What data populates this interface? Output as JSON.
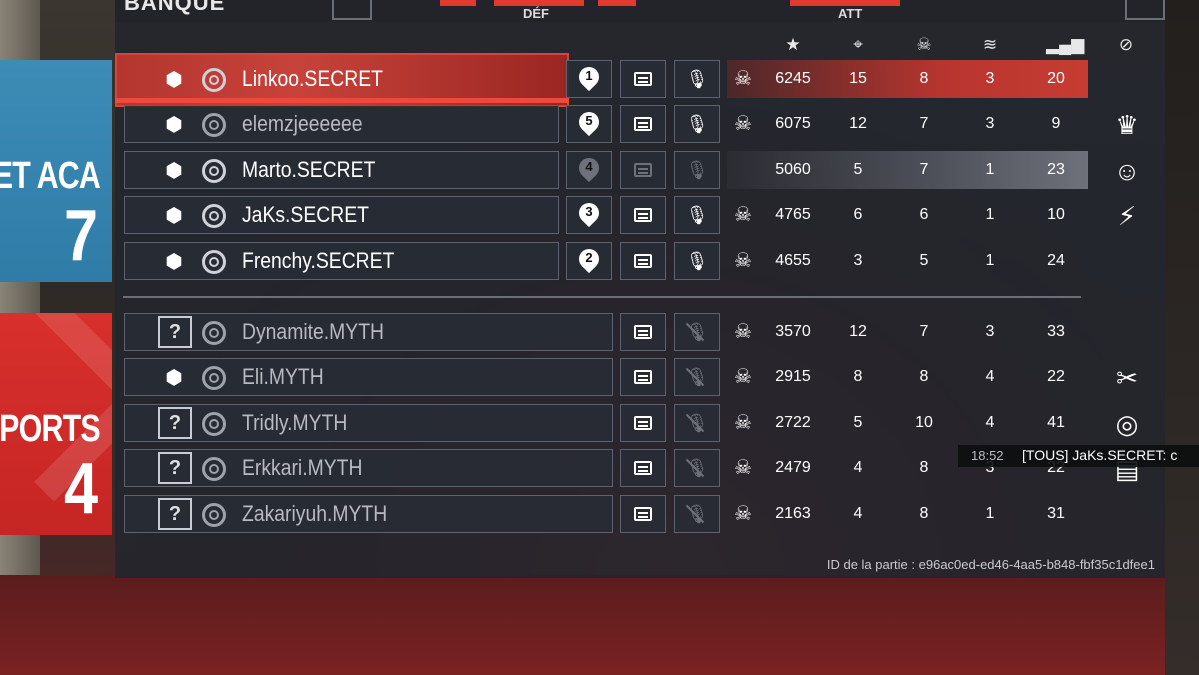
{
  "top": {
    "title": "BANQUE",
    "def_label": "DÉF",
    "att_label": "ATT"
  },
  "teams": [
    {
      "name": "ET ACA",
      "score": "7",
      "color": "#3a8ab4"
    },
    {
      "name": "PORTS",
      "score": "4",
      "color": "#d02a28"
    }
  ],
  "header_icons": [
    "star-icon",
    "crosshair-icon",
    "skull-icon",
    "wings-icon",
    "ping-bars-icon",
    "slash-circle-icon"
  ],
  "players": [
    {
      "name": "Linkoo.SECRET",
      "op": "op-icon",
      "pin": "1",
      "score": "6245",
      "kills": "15",
      "deaths": "8",
      "assists": "3",
      "ping": "20",
      "highlight": "red"
    },
    {
      "name": "elemzjeeeeee",
      "op": "op-icon",
      "pin": "5",
      "score": "6075",
      "kills": "12",
      "deaths": "7",
      "assists": "3",
      "ping": "9",
      "dim": true,
      "badge": "crown"
    },
    {
      "name": "Marto.SECRET",
      "op": "op-icon",
      "pin": "4",
      "score": "5060",
      "kills": "5",
      "deaths": "7",
      "assists": "1",
      "ping": "23",
      "disabled": true,
      "highlight": "gray",
      "badge": "face"
    },
    {
      "name": "JaKs.SECRET",
      "op": "op-icon",
      "pin": "3",
      "score": "4765",
      "kills": "6",
      "deaths": "6",
      "assists": "1",
      "ping": "10",
      "badge": "bolt"
    },
    {
      "name": "Frenchy.SECRET",
      "op": "op-icon",
      "pin": "2",
      "score": "4655",
      "kills": "3",
      "deaths": "5",
      "assists": "1",
      "ping": "24"
    },
    {
      "name": "Dynamite.MYTH",
      "op": "?",
      "score": "3570",
      "kills": "12",
      "deaths": "7",
      "assists": "3",
      "ping": "33",
      "dim": true
    },
    {
      "name": "Eli.MYTH",
      "op": "op-icon",
      "score": "2915",
      "kills": "8",
      "deaths": "8",
      "assists": "4",
      "ping": "22",
      "dim": true,
      "badge": "knife"
    },
    {
      "name": "Tridly.MYTH",
      "op": "?",
      "score": "2722",
      "kills": "5",
      "deaths": "10",
      "assists": "4",
      "ping": "41",
      "dim": true,
      "badge": "target"
    },
    {
      "name": "Erkkari.MYTH",
      "op": "?",
      "score": "2479",
      "kills": "4",
      "deaths": "8",
      "assists": "3",
      "ping": "22",
      "dim": true,
      "badge": "stripes"
    },
    {
      "name": "Zakariyuh.MYTH",
      "op": "?",
      "score": "2163",
      "kills": "4",
      "deaths": "8",
      "assists": "1",
      "ping": "31",
      "dim": true
    }
  ],
  "match_id": "ID de la partie : e96ac0ed-ed46-4aa5-b848-fbf35c1dfee1",
  "chat": {
    "time": "18:52",
    "message": "[TOUS] JaKs.SECRET: c"
  }
}
